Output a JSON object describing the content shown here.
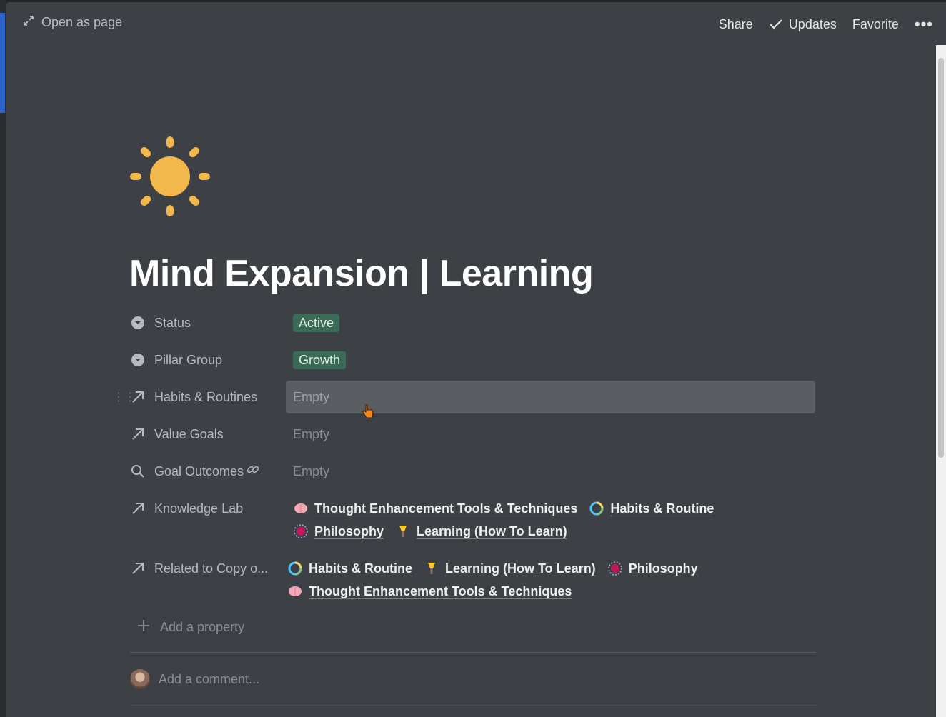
{
  "topbar": {
    "open_as_page": "Open as page",
    "share": "Share",
    "updates": "Updates",
    "favorite": "Favorite",
    "more": "•••"
  },
  "page": {
    "icon": "sun-icon",
    "title": "Mind Expansion | Learning"
  },
  "properties": {
    "status": {
      "label": "Status",
      "value": "Active"
    },
    "pillar_group": {
      "label": "Pillar Group",
      "value": "Growth"
    },
    "habits_routines": {
      "label": "Habits & Routines",
      "value": "Empty"
    },
    "value_goals": {
      "label": "Value Goals",
      "value": "Empty"
    },
    "goal_outcomes": {
      "label": "Goal Outcomes",
      "value": "Empty"
    },
    "knowledge_lab": {
      "label": "Knowledge Lab",
      "items": [
        "Thought Enhancement Tools & Techniques",
        "Habits & Routine",
        "Philosophy",
        "Learning (How To Learn)"
      ]
    },
    "related": {
      "label": "Related to Copy o...",
      "items": [
        "Habits & Routine",
        "Learning (How To Learn)",
        "Philosophy",
        "Thought Enhancement Tools & Techniques"
      ]
    }
  },
  "add_property": "Add a property",
  "comment_placeholder": "Add a comment...",
  "colors": {
    "panel_bg": "#3d4045",
    "tag_bg": "#3b6b57",
    "sun": "#f2b84b"
  }
}
